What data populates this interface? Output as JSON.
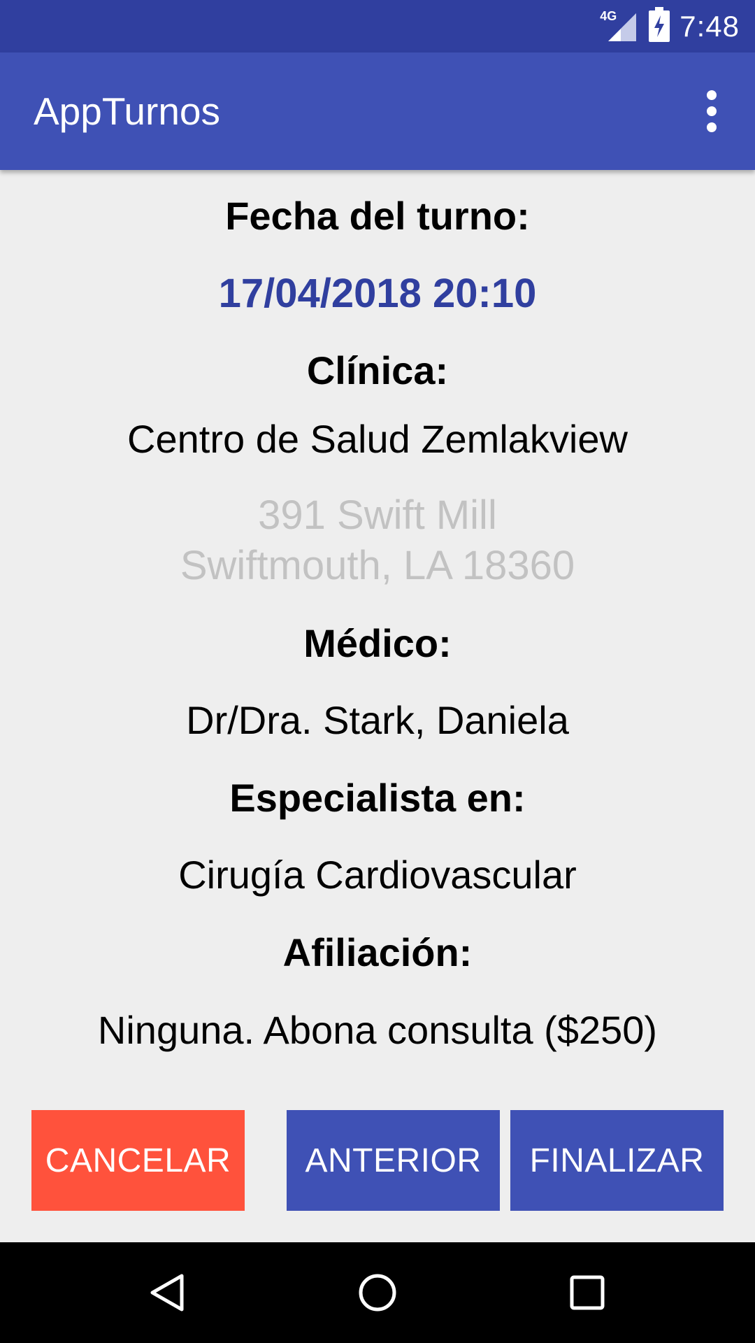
{
  "status_bar": {
    "network": "4G",
    "time": "7:48"
  },
  "app_bar": {
    "title": "AppTurnos",
    "overflow_icon": "more-vert-icon"
  },
  "details": {
    "date_label": "Fecha del turno:",
    "date_value": "17/04/2018 20:10",
    "clinic_label": "Clínica:",
    "clinic_name": "Centro de Salud Zemlakview",
    "clinic_address_line1": "391 Swift Mill",
    "clinic_address_line2": "Swiftmouth, LA 18360",
    "doctor_label": "Médico:",
    "doctor_name": "Dr/Dra. Stark, Daniela",
    "specialty_label": "Especialista en:",
    "specialty_value": "Cirugía Cardiovascular",
    "affiliation_label": "Afiliación:",
    "affiliation_value": "Ninguna. Abona consulta ($250)"
  },
  "actions": {
    "cancel": "CANCELAR",
    "previous": "ANTERIOR",
    "finish": "FINALIZAR"
  },
  "colors": {
    "primary": "#3f51b5",
    "primary_dark": "#303f9f",
    "cancel": "#ff523c",
    "address_gray": "#c2c2c2"
  },
  "nav_bar": {
    "icons": [
      "back-icon",
      "home-icon",
      "recents-icon"
    ]
  }
}
